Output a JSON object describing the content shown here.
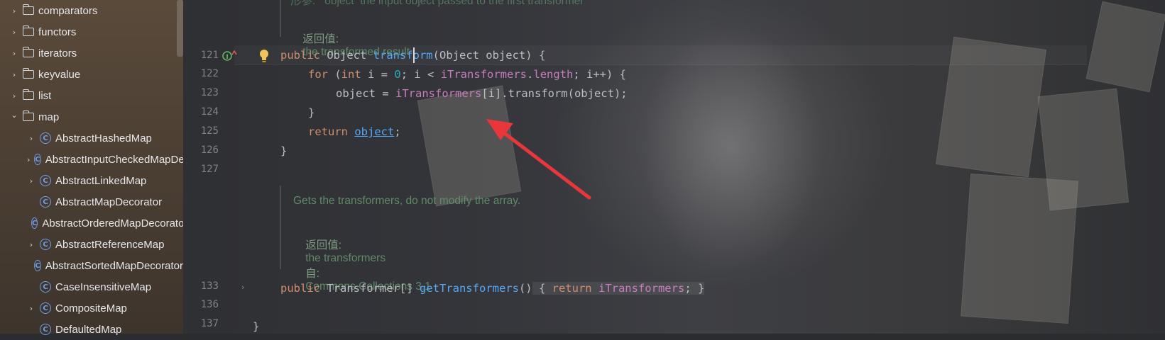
{
  "project_tree": [
    {
      "type": "folder",
      "label": "comparators",
      "expandable": true,
      "expanded": false
    },
    {
      "type": "folder",
      "label": "functors",
      "expandable": true,
      "expanded": false
    },
    {
      "type": "folder",
      "label": "iterators",
      "expandable": true,
      "expanded": false
    },
    {
      "type": "folder",
      "label": "keyvalue",
      "expandable": true,
      "expanded": false
    },
    {
      "type": "folder",
      "label": "list",
      "expandable": true,
      "expanded": false
    },
    {
      "type": "folder",
      "label": "map",
      "expandable": true,
      "expanded": true
    },
    {
      "type": "class",
      "label": "AbstractHashedMap",
      "expandable": true
    },
    {
      "type": "class",
      "label": "AbstractInputCheckedMapDecorator",
      "expandable": true
    },
    {
      "type": "class",
      "label": "AbstractLinkedMap",
      "expandable": true
    },
    {
      "type": "class",
      "label": "AbstractMapDecorator",
      "expandable": false
    },
    {
      "type": "class",
      "label": "AbstractOrderedMapDecorator",
      "expandable": false
    },
    {
      "type": "class",
      "label": "AbstractReferenceMap",
      "expandable": true
    },
    {
      "type": "class",
      "label": "AbstractSortedMapDecorator",
      "expandable": false
    },
    {
      "type": "class",
      "label": "CaseInsensitiveMap",
      "expandable": false
    },
    {
      "type": "class",
      "label": "CompositeMap",
      "expandable": true
    },
    {
      "type": "class",
      "label": "DefaultedMap",
      "expandable": false
    }
  ],
  "editor": {
    "doc_top_partial": "形参:   object  the input object passed to the first transformer",
    "doc_top_return_label": "返回值:",
    "doc_top_return_text": "the transformed result",
    "line_numbers": [
      "121",
      "122",
      "123",
      "124",
      "125",
      "126",
      "127",
      "133",
      "136",
      "137"
    ],
    "code": {
      "l121": [
        "public",
        " Object ",
        "transform",
        "(Object object) {"
      ],
      "l122": [
        "for",
        " (",
        "int",
        " i = ",
        "0",
        "; i < ",
        "iTransformers",
        ".",
        "length",
        "; i++) {"
      ],
      "l123": [
        "object = ",
        "iTransformers",
        "[i].transform(object);"
      ],
      "l124": "}",
      "l125": [
        "return",
        " ",
        "object",
        ";"
      ],
      "l126": "}",
      "l133": [
        "public",
        " Transformer[] ",
        "getTransformers",
        "()",
        " { ",
        "return",
        " ",
        "iTransformers",
        "; }"
      ],
      "l137": "}"
    },
    "doc2": {
      "summary": "Gets the transformers, do not modify the array.",
      "return_label": "返回值:",
      "return_text": "the transformers",
      "since_label": "自:",
      "since_text": "Commons Collections 3.1"
    }
  },
  "colors": {
    "keyword": "#cf8e6d",
    "method": "#56a8f5",
    "field": "#c77dbb",
    "number": "#2aacb8",
    "arrow": "#e8363a"
  },
  "icons": {
    "folder": "folder-icon",
    "class": "class-c-icon",
    "bulb": "lightbulb-icon",
    "override": "implements-icon"
  }
}
